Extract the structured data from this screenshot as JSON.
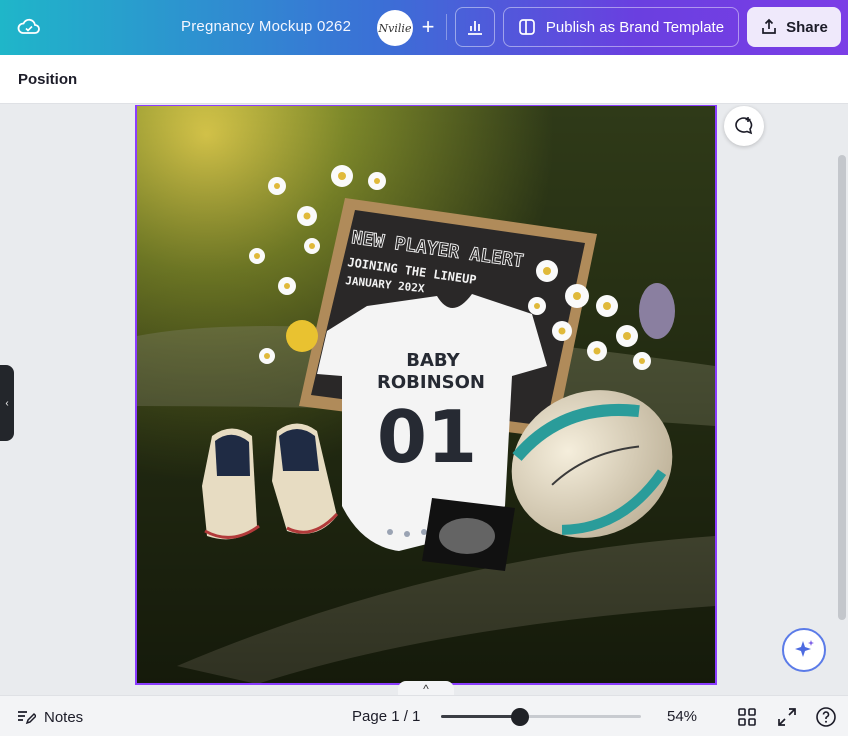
{
  "header": {
    "doc_title": "Pregnancy Mockup 0262",
    "avatar_text": "Nvilie",
    "publish_label": "Publish as Brand Template",
    "share_label": "Share",
    "icons": {
      "cloud": "cloud-sync-icon",
      "add": "plus-icon",
      "insights": "bar-chart-icon",
      "publish": "template-icon",
      "share": "share-upload-icon"
    }
  },
  "context_toolbar": {
    "position_label": "Position"
  },
  "design": {
    "letterboard": {
      "line1": "NEW PLAYER ALERT",
      "line2": "JOINING THE LINEUP",
      "line3": "JANUARY 202X"
    },
    "onesie": {
      "line1": "BABY",
      "line2": "ROBINSON",
      "number": "01"
    }
  },
  "canvas": {
    "side_handle_glyph": "‹",
    "expand_glyph": "^"
  },
  "footer": {
    "notes_label": "Notes",
    "page_label": "Page 1 / 1",
    "zoom_percent": 54,
    "zoom_label": "54%",
    "icons": {
      "notes": "notes-icon",
      "grid": "grid-view-icon",
      "fullscreen": "fullscreen-icon",
      "help": "help-icon"
    }
  },
  "colors": {
    "accent": "#8b3dff",
    "share_bg": "#efe9fb",
    "topbar_start": "#1fb6c9",
    "topbar_end": "#7b3ee6"
  }
}
